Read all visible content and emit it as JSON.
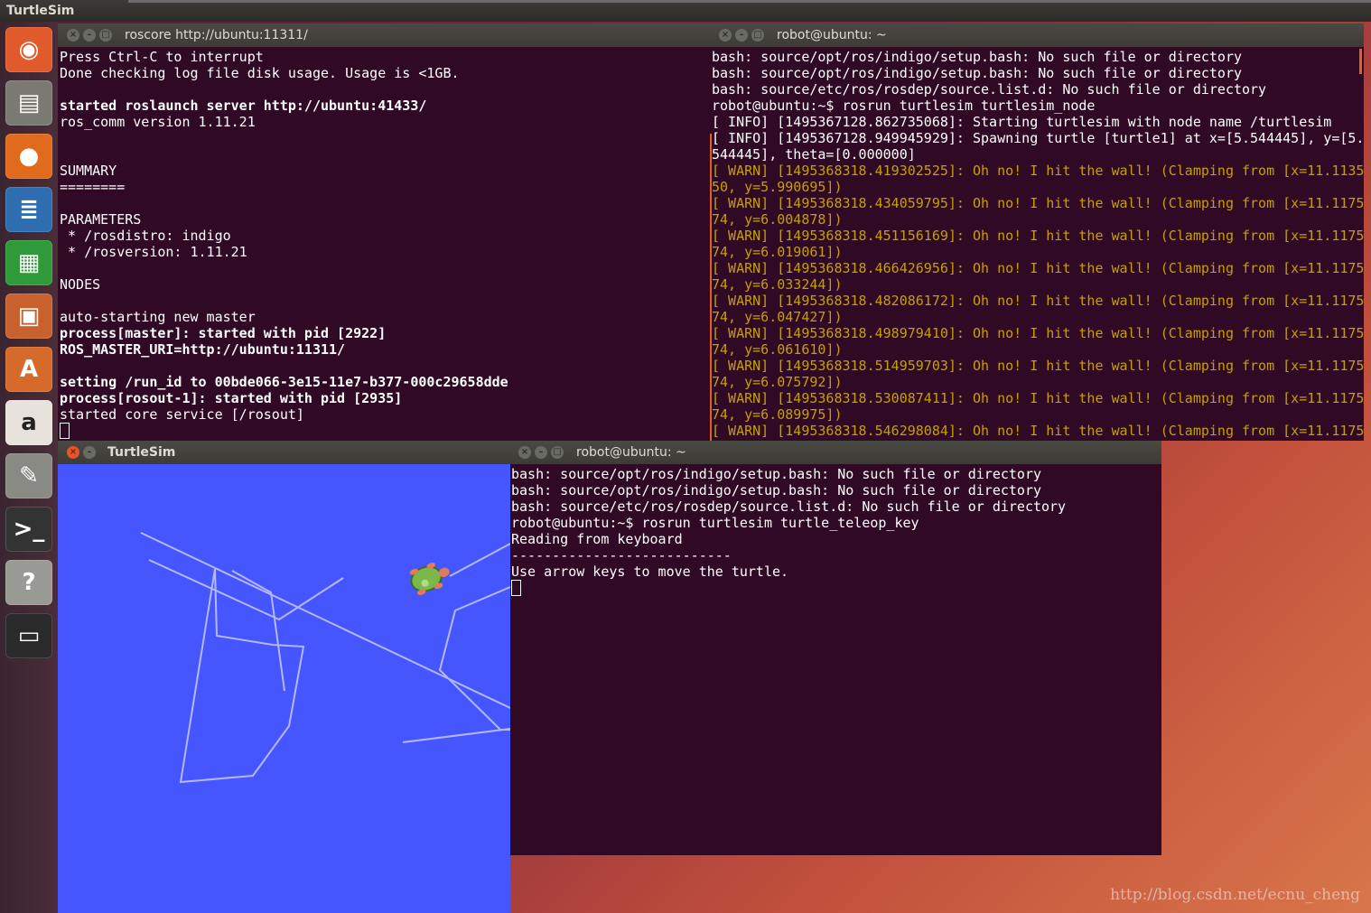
{
  "topbar": {
    "title": "TurtleSim"
  },
  "launcher": {
    "items": [
      {
        "name": "ubuntu-dash-icon",
        "glyph": "◉",
        "color": "#e05a2b"
      },
      {
        "name": "files-icon",
        "glyph": "▤",
        "color": "#7a7a72"
      },
      {
        "name": "firefox-icon",
        "glyph": "●",
        "color": "#e06b1d"
      },
      {
        "name": "writer-icon",
        "glyph": "≣",
        "color": "#2d6db0"
      },
      {
        "name": "calc-icon",
        "glyph": "▦",
        "color": "#2f9a3a"
      },
      {
        "name": "impress-icon",
        "glyph": "▣",
        "color": "#c9612f"
      },
      {
        "name": "software-center-icon",
        "glyph": "A",
        "color": "#d66a2a"
      },
      {
        "name": "amazon-icon",
        "glyph": "a",
        "color": "#e7e3dc"
      },
      {
        "name": "settings-icon",
        "glyph": "✎",
        "color": "#8a8a84"
      },
      {
        "name": "terminal-icon",
        "glyph": ">_",
        "color": "#333333"
      },
      {
        "name": "help-icon",
        "glyph": "?",
        "color": "#9a9a94"
      },
      {
        "name": "save-icon",
        "glyph": "▭",
        "color": "#2a2a2a"
      }
    ]
  },
  "roscore": {
    "title": "roscore http://ubuntu:11311/",
    "lines": [
      {
        "t": "Press Ctrl-C to interrupt",
        "s": ""
      },
      {
        "t": "Done checking log file disk usage. Usage is <1GB.",
        "s": ""
      },
      {
        "t": "",
        "s": ""
      },
      {
        "t": "started roslaunch server http://ubuntu:41433/",
        "s": "b"
      },
      {
        "t": "ros_comm version 1.11.21",
        "s": ""
      },
      {
        "t": "",
        "s": ""
      },
      {
        "t": "",
        "s": ""
      },
      {
        "t": "SUMMARY",
        "s": ""
      },
      {
        "t": "========",
        "s": ""
      },
      {
        "t": "",
        "s": ""
      },
      {
        "t": "PARAMETERS",
        "s": ""
      },
      {
        "t": " * /rosdistro: indigo",
        "s": ""
      },
      {
        "t": " * /rosversion: 1.11.21",
        "s": ""
      },
      {
        "t": "",
        "s": ""
      },
      {
        "t": "NODES",
        "s": ""
      },
      {
        "t": "",
        "s": ""
      },
      {
        "t": "auto-starting new master",
        "s": ""
      },
      {
        "t": "process[master]: started with pid [2922]",
        "s": "b"
      },
      {
        "t": "ROS_MASTER_URI=http://ubuntu:11311/",
        "s": "b"
      },
      {
        "t": "",
        "s": ""
      },
      {
        "t": "setting /run_id to 00bde066-3e15-11e7-b377-000c29658dde",
        "s": "b"
      },
      {
        "t": "process[rosout-1]: started with pid [2935]",
        "s": "b"
      },
      {
        "t": "started core service [/rosout]",
        "s": ""
      }
    ]
  },
  "node_term": {
    "title": "robot@ubuntu: ~",
    "lines": [
      {
        "t": "bash: source/opt/ros/indigo/setup.bash: No such file or directory",
        "s": ""
      },
      {
        "t": "bash: source/opt/ros/indigo/setup.bash: No such file or directory",
        "s": ""
      },
      {
        "t": "bash: source/etc/ros/rosdep/source.list.d: No such file or directory",
        "s": ""
      },
      {
        "t": "robot@ubuntu:~$ rosrun turtlesim turtlesim_node",
        "s": ""
      },
      {
        "t": "[ INFO] [1495367128.862735068]: Starting turtlesim with node name /turtlesim",
        "s": ""
      },
      {
        "t": "[ INFO] [1495367128.949945929]: Spawning turtle [turtle1] at x=[5.544445], y=[5.",
        "s": ""
      },
      {
        "t": "544445], theta=[0.000000]",
        "s": ""
      },
      {
        "t": "[ WARN] [1495368318.419302525]: Oh no! I hit the wall! (Clamping from [x=11.1135",
        "s": "w"
      },
      {
        "t": "50, y=5.990695])",
        "s": "w"
      },
      {
        "t": "[ WARN] [1495368318.434059795]: Oh no! I hit the wall! (Clamping from [x=11.1175",
        "s": "w"
      },
      {
        "t": "74, y=6.004878])",
        "s": "w"
      },
      {
        "t": "[ WARN] [1495368318.451156169]: Oh no! I hit the wall! (Clamping from [x=11.1175",
        "s": "w"
      },
      {
        "t": "74, y=6.019061])",
        "s": "w"
      },
      {
        "t": "[ WARN] [1495368318.466426956]: Oh no! I hit the wall! (Clamping from [x=11.1175",
        "s": "w"
      },
      {
        "t": "74, y=6.033244])",
        "s": "w"
      },
      {
        "t": "[ WARN] [1495368318.482086172]: Oh no! I hit the wall! (Clamping from [x=11.1175",
        "s": "w"
      },
      {
        "t": "74, y=6.047427])",
        "s": "w"
      },
      {
        "t": "[ WARN] [1495368318.498979410]: Oh no! I hit the wall! (Clamping from [x=11.1175",
        "s": "w"
      },
      {
        "t": "74, y=6.061610])",
        "s": "w"
      },
      {
        "t": "[ WARN] [1495368318.514959703]: Oh no! I hit the wall! (Clamping from [x=11.1175",
        "s": "w"
      },
      {
        "t": "74, y=6.075792])",
        "s": "w"
      },
      {
        "t": "[ WARN] [1495368318.530087411]: Oh no! I hit the wall! (Clamping from [x=11.1175",
        "s": "w"
      },
      {
        "t": "74, y=6.089975])",
        "s": "w"
      },
      {
        "t": "[ WARN] [1495368318.546298084]: Oh no! I hit the wall! (Clamping from [x=11.1175",
        "s": "w"
      }
    ]
  },
  "turtlesim": {
    "title": "TurtleSim",
    "bg": "#4556ff",
    "trail": "#b3b8ff"
  },
  "teleop_term": {
    "title": "robot@ubuntu: ~",
    "lines": [
      {
        "t": "bash: source/opt/ros/indigo/setup.bash: No such file or directory",
        "s": ""
      },
      {
        "t": "bash: source/opt/ros/indigo/setup.bash: No such file or directory",
        "s": ""
      },
      {
        "t": "bash: source/etc/ros/rosdep/source.list.d: No such file or directory",
        "s": ""
      },
      {
        "t": "robot@ubuntu:~$ rosrun turtlesim turtle_teleop_key",
        "s": ""
      },
      {
        "t": "Reading from keyboard",
        "s": ""
      },
      {
        "t": "---------------------------",
        "s": ""
      },
      {
        "t": "Use arrow keys to move the turtle.",
        "s": ""
      }
    ]
  },
  "watermark": "http://blog.csdn.net/ecnu_cheng"
}
